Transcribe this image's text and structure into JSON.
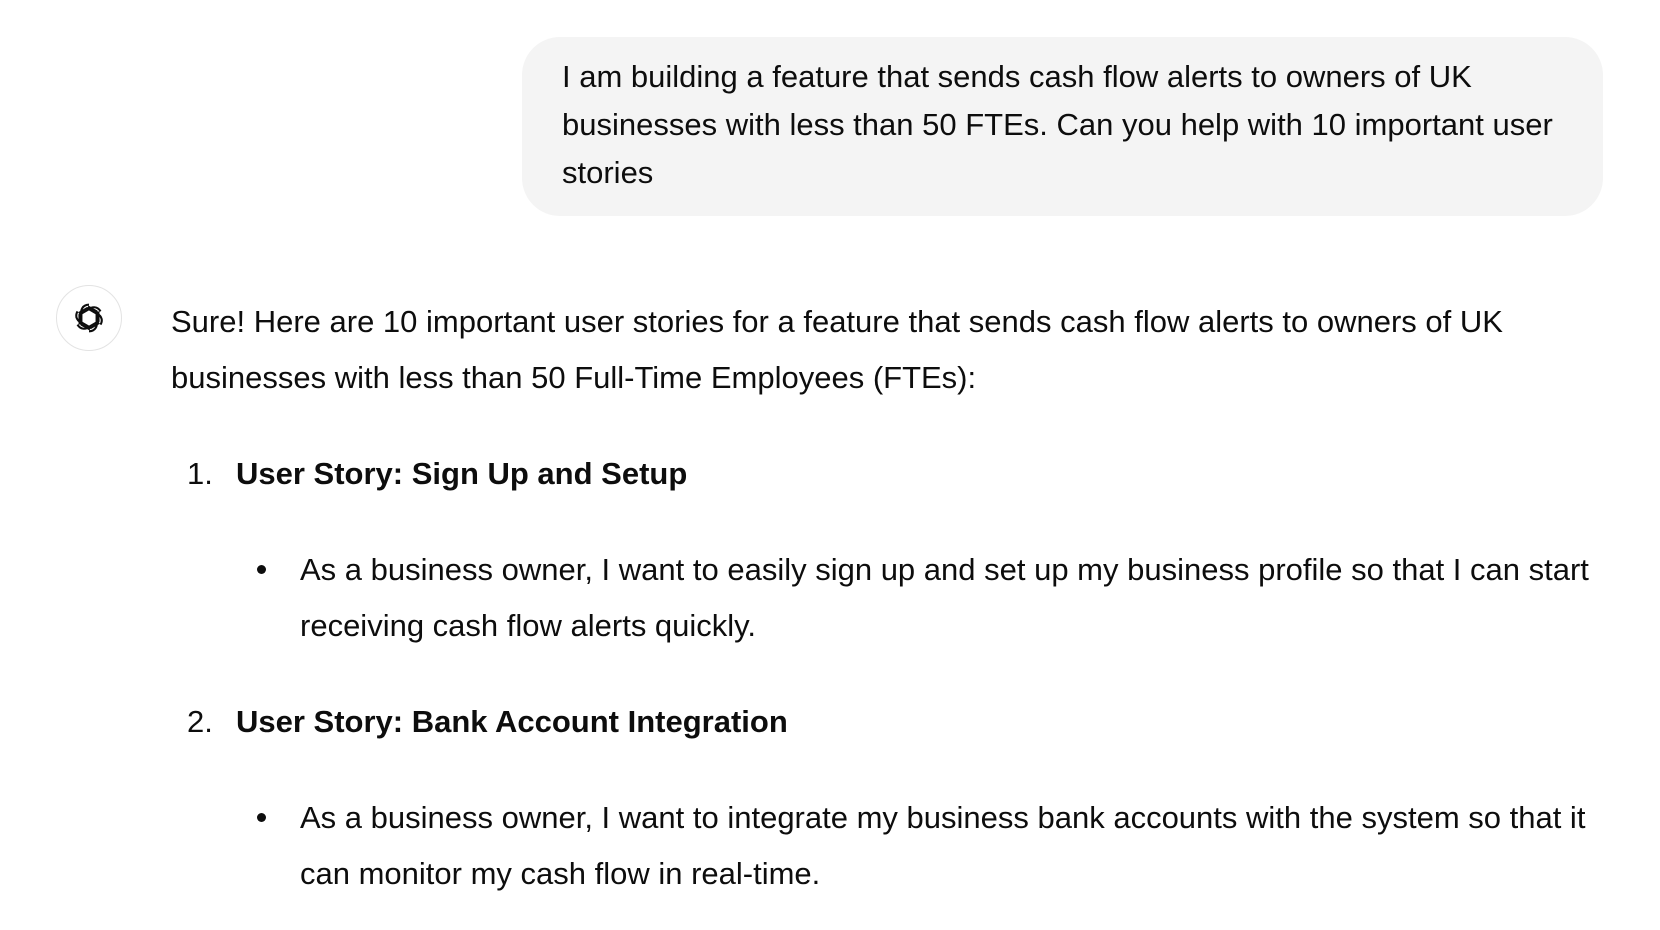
{
  "user_message": {
    "text": "I am building a feature that sends cash flow alerts to owners of UK businesses with less than 50 FTEs. Can you help with 10 important user stories"
  },
  "assistant": {
    "avatar_icon": "openai-logo-icon",
    "intro": "Sure! Here are 10 important user stories for a feature that sends cash flow alerts to owners of UK businesses with less than 50 Full-Time Employees (FTEs):",
    "items": [
      {
        "number": "1.",
        "title": "User Story: Sign Up and Setup",
        "bullet": "As a business owner, I want to easily sign up and set up my business profile so that I can start receiving cash flow alerts quickly."
      },
      {
        "number": "2.",
        "title": "User Story: Bank Account Integration",
        "bullet": "As a business owner, I want to integrate my business bank accounts with the system so that it can monitor my cash flow in real-time."
      }
    ]
  }
}
